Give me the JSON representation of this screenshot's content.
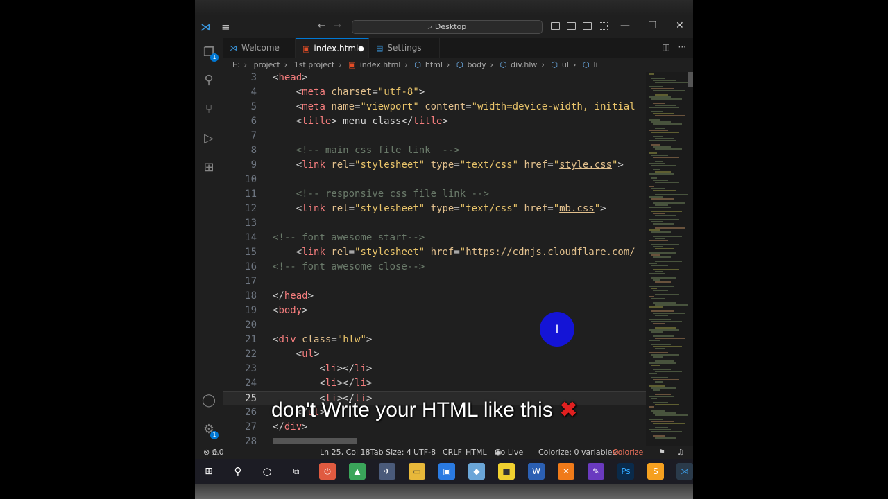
{
  "titlebar": {
    "search_text": "Desktop",
    "menu_icon": "hamburger-menu-icon",
    "back_icon": "arrow-left-icon",
    "forward_icon": "arrow-right-icon"
  },
  "tabs": [
    {
      "label": "Welcome",
      "icon": "vscode-icon",
      "active": false
    },
    {
      "label": "index.html",
      "icon": "html5-icon",
      "active": true,
      "modified": true
    },
    {
      "label": "Settings",
      "icon": "file-icon",
      "active": false
    }
  ],
  "breadcrumb": [
    "E:",
    "project",
    "1st project",
    "index.html",
    "html",
    "body",
    "div.hlw",
    "ul",
    "li"
  ],
  "code_lines": [
    {
      "n": "3"
    },
    {
      "n": "4"
    },
    {
      "n": "5"
    },
    {
      "n": "6"
    },
    {
      "n": "7"
    },
    {
      "n": "8"
    },
    {
      "n": "9"
    },
    {
      "n": "10"
    },
    {
      "n": "11"
    },
    {
      "n": "12"
    },
    {
      "n": "13"
    },
    {
      "n": "14"
    },
    {
      "n": "15"
    },
    {
      "n": "16"
    },
    {
      "n": "17"
    },
    {
      "n": "18"
    },
    {
      "n": "19"
    },
    {
      "n": "20"
    },
    {
      "n": "21"
    },
    {
      "n": "22"
    },
    {
      "n": "23"
    },
    {
      "n": "24"
    },
    {
      "n": "25"
    },
    {
      "n": "26"
    },
    {
      "n": "27"
    },
    {
      "n": "28"
    }
  ],
  "code": {
    "l3_tag": "head",
    "meta": "meta",
    "charset_attr": "charset",
    "charset_val": "\"utf-8\"",
    "name_attr": "name",
    "name_val": "\"viewport\"",
    "content_attr": "content",
    "content_val": "\"width=device-width, initial",
    "title_tag": "title",
    "title_text": " menu class",
    "comment_main": "<!-- main css file link  -->",
    "link_tag": "link",
    "rel_attr": "rel",
    "rel_val": "\"stylesheet\"",
    "type_attr": "type",
    "type_val": "\"text/css\"",
    "href_attr": "href",
    "href_style": "style.css",
    "comment_resp": "<!-- responsive css file link -->",
    "href_mb": "mb.css",
    "comment_fa_start": "<!-- font awesome start-->",
    "href_cdn": "https://cdnjs.cloudflare.com/",
    "comment_fa_close": "<!-- font awesome close-->",
    "body_tag": "body",
    "div_tag": "div",
    "class_attr": "class",
    "class_val": "\"hlw\"",
    "ul_tag": "ul",
    "li_tag": "li"
  },
  "overlay": {
    "text": "don't Write your HTML like this",
    "mark": "✖"
  },
  "cursor_glyph": "I",
  "statusbar": {
    "errors": "0",
    "warnings": "0",
    "position": "Ln 25, Col 18",
    "tab_size": "Tab Size: 4",
    "encoding": "UTF-8",
    "eol": "CRLF",
    "language": "HTML",
    "go_live": "Go Live",
    "colorize_vars": "Colorize: 0 variables",
    "colorize": "Colorize"
  },
  "activity_badge": "1",
  "settings_badge": "1",
  "colors": {
    "accent": "#0078d4",
    "cursor_circle": "#1414d6",
    "overlay_mark": "#e02020"
  }
}
